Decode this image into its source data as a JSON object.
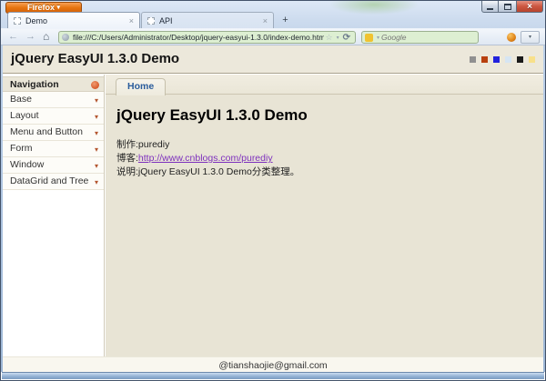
{
  "browser": {
    "firefox_button": {
      "label": "Firefox"
    },
    "tabs": [
      {
        "title": "Demo"
      },
      {
        "title": "API"
      }
    ],
    "address_bar": {
      "url": "file:///C:/Users/Administrator/Desktop/jquery-easyui-1.3.0/index-demo.html"
    },
    "search_bar": {
      "placeholder": "Google"
    }
  },
  "icons": {
    "firefox_caret": "▾",
    "back": "←",
    "forward": "→",
    "home": "⌂",
    "star": "☆",
    "url_caret": "▾",
    "refresh": "⟳",
    "search_caret": "▾",
    "toolbar_caret": "▾",
    "tab_close": "×",
    "new_tab": "+",
    "window_close": "×",
    "accordion_arrow": "▾"
  },
  "page": {
    "header": {
      "title": "jQuery EasyUI 1.3.0 Demo",
      "theme_colors": [
        "#909090",
        "#b8400e",
        "#2222dd",
        "#d6e5f3",
        "#1a1a1a",
        "#f8e08a"
      ]
    },
    "sidebar": {
      "title": "Navigation",
      "items": [
        "Base",
        "Layout",
        "Menu and Button",
        "Form",
        "Window",
        "DataGrid and Tree"
      ]
    },
    "main": {
      "tab": "Home",
      "heading": "jQuery EasyUI 1.3.0 Demo",
      "lines": [
        {
          "label": "制作:",
          "value": "purediy"
        },
        {
          "label": "博客:",
          "value": "http://www.cnblogs.com/purediy"
        },
        {
          "label": "说明:",
          "value": "jQuery EasyUI 1.3.0 Demo分类整理。"
        }
      ]
    },
    "footer": {
      "email": "@tianshaojie@gmail.com"
    }
  }
}
